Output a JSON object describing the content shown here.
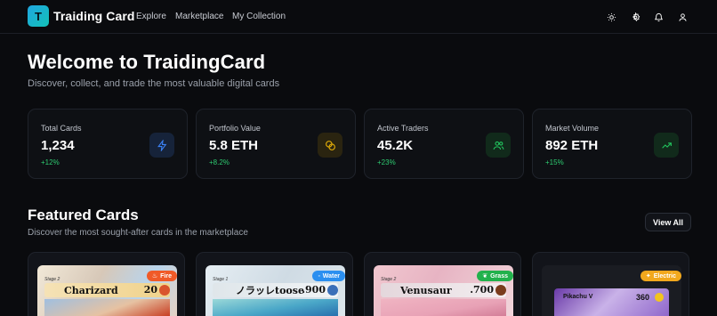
{
  "nav": {
    "logo_letter": "T",
    "brand": "Traiding Card",
    "links": [
      "Explore",
      "Marketplace",
      "My Collection"
    ],
    "icons": [
      "sun-icon",
      "settings-icon",
      "bell-icon",
      "user-icon"
    ]
  },
  "hero": {
    "title": "Welcome to TraidingCard",
    "subtitle": "Discover, collect, and trade the most valuable digital cards"
  },
  "stats": [
    {
      "label": "Total Cards",
      "value": "1,234",
      "delta": "+12%",
      "icon": "lightning-icon",
      "color": "#3b82f6"
    },
    {
      "label": "Portfolio Value",
      "value": "5.8 ETH",
      "delta": "+8.2%",
      "icon": "coins-icon",
      "color": "#eab308"
    },
    {
      "label": "Active Traders",
      "value": "45.2K",
      "delta": "+23%",
      "icon": "users-icon",
      "color": "#22c55e"
    },
    {
      "label": "Market Volume",
      "value": "892 ETH",
      "delta": "+15%",
      "icon": "trending-up-icon",
      "color": "#22c55e"
    }
  ],
  "featured": {
    "title": "Featured Cards",
    "subtitle": "Discover the most sought-after cards in the marketplace",
    "view_all": "View All",
    "cards": [
      {
        "name": "Charizard",
        "hp": "20",
        "type": "Fire",
        "stage": "Stage 2",
        "badge_color": "#f05a28"
      },
      {
        "name": "ノラッレtoose",
        "hp": ".900",
        "type": "Water",
        "stage": "Stage 1",
        "badge_color": "#2b8ff0"
      },
      {
        "name": "Venusaur",
        "hp": ".700",
        "type": "Grass",
        "stage": "Stage 2",
        "badge_color": "#22b14c"
      },
      {
        "name": "Pikachu V",
        "hp": "360",
        "type": "Electric",
        "stage": "",
        "badge_color": "#f2a81d"
      }
    ]
  }
}
